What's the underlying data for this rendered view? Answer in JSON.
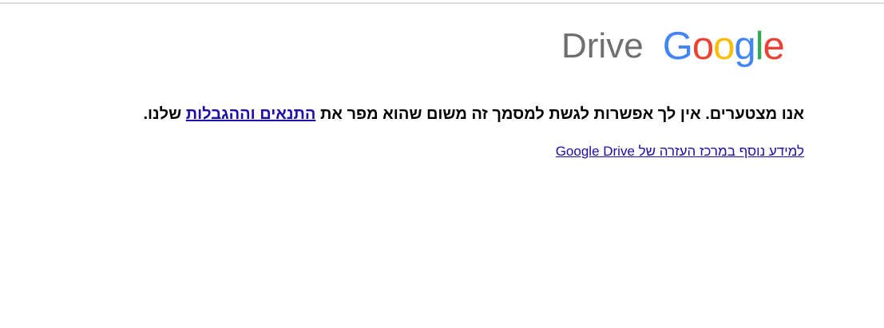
{
  "logo": {
    "product": "Drive",
    "brand_letters": [
      {
        "char": "G",
        "color": "#4285F4"
      },
      {
        "char": "o",
        "color": "#EA4335"
      },
      {
        "char": "o",
        "color": "#FBBC05"
      },
      {
        "char": "g",
        "color": "#4285F4"
      },
      {
        "char": "l",
        "color": "#34A853"
      },
      {
        "char": "e",
        "color": "#EA4335"
      }
    ]
  },
  "message": {
    "before_link": "אנו מצטערים. אין לך אפשרות לגשת למסמך זה משום שהוא מפר את ",
    "link_text": "התנאים וההגבלות",
    "after_link": " שלנו."
  },
  "help_link": {
    "text": "למידע נוסף במרכז העזרה של Google Drive"
  },
  "colors": {
    "link": "#1a0dab",
    "drive_gray": "#6f6f6f",
    "divider": "#dadce0"
  }
}
